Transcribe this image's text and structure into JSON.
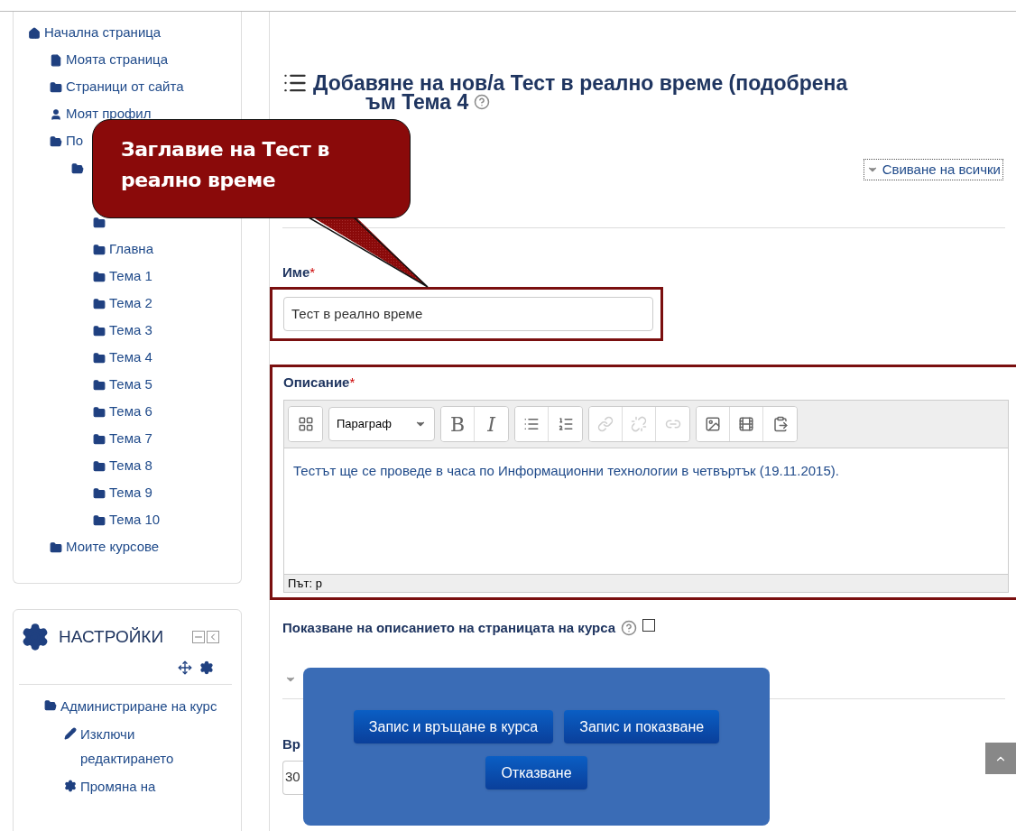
{
  "nav": {
    "items": [
      {
        "label": "Начална страница",
        "kind": "home",
        "children": [
          {
            "label": "Моята страница",
            "kind": "page"
          },
          {
            "label": "Страници от сайта",
            "kind": "folder"
          },
          {
            "label": "Моят профил",
            "kind": "user"
          },
          {
            "label": "По",
            "kind": "folder-open",
            "children": [
              {
                "kind": "folder-open",
                "children": [
                  {
                    "kind": "folder"
                  },
                  {
                    "label": "Главна",
                    "kind": "folder"
                  },
                  {
                    "label": "Тема 1",
                    "kind": "folder"
                  },
                  {
                    "label": "Тема 2",
                    "kind": "folder"
                  },
                  {
                    "label": "Тема 3",
                    "kind": "folder"
                  },
                  {
                    "label": "Тема 4",
                    "kind": "folder"
                  },
                  {
                    "label": "Тема 5",
                    "kind": "folder"
                  },
                  {
                    "label": "Тема 6",
                    "kind": "folder"
                  },
                  {
                    "label": "Тема 7",
                    "kind": "folder"
                  },
                  {
                    "label": "Тема 8",
                    "kind": "folder"
                  },
                  {
                    "label": "Тема 9",
                    "kind": "folder"
                  },
                  {
                    "label": "Тема 10",
                    "kind": "folder"
                  }
                ]
              }
            ]
          },
          {
            "label": "Моите курсове",
            "kind": "folder"
          }
        ]
      }
    ]
  },
  "settings": {
    "title": "НАСТРОЙКИ",
    "items": [
      {
        "label": "Администриране на курс",
        "kind": "folder-open",
        "children": [
          {
            "label": "Изключи редактирането",
            "kind": "pencil"
          },
          {
            "label": "Промяна на",
            "kind": "gears"
          }
        ]
      }
    ]
  },
  "heading": {
    "line_1": "Добавяне на нов/а Тест в реално време (подобрена",
    "line_2": "ъм Тема 4"
  },
  "collapse_all": "Свиване на всички",
  "name_field": {
    "label": "Име",
    "required_mark": "*",
    "value": "Тест в реално време"
  },
  "description": {
    "label": "Описание",
    "required_mark": "*",
    "format": "Параграф",
    "tools": [
      {
        "kind": "toggle",
        "disabled": false
      },
      {
        "kind": "bold",
        "text": "B",
        "disabled": false
      },
      {
        "kind": "italic",
        "text": "I",
        "disabled": false
      },
      {
        "kind": "bullets",
        "disabled": false
      },
      {
        "kind": "numbers",
        "disabled": false
      },
      {
        "kind": "link",
        "disabled": true
      },
      {
        "kind": "unlink",
        "disabled": true
      },
      {
        "kind": "anchor",
        "disabled": true
      },
      {
        "kind": "image",
        "disabled": false
      },
      {
        "kind": "media",
        "disabled": false
      },
      {
        "kind": "paste",
        "disabled": false
      }
    ],
    "text": "Тестът ще се проведе в часа по Информационни технологии в четвъртък (19.11.2015).",
    "path": "Път: p"
  },
  "show_description": {
    "label": "Показване на описанието на страницата на курса",
    "checked": false
  },
  "time_label": "Вр",
  "time_value": "30",
  "callout": "Заглавие на Тест в реално време",
  "actions": [
    "Запис и връщане в курса",
    "Запис и показване",
    "Отказване"
  ]
}
